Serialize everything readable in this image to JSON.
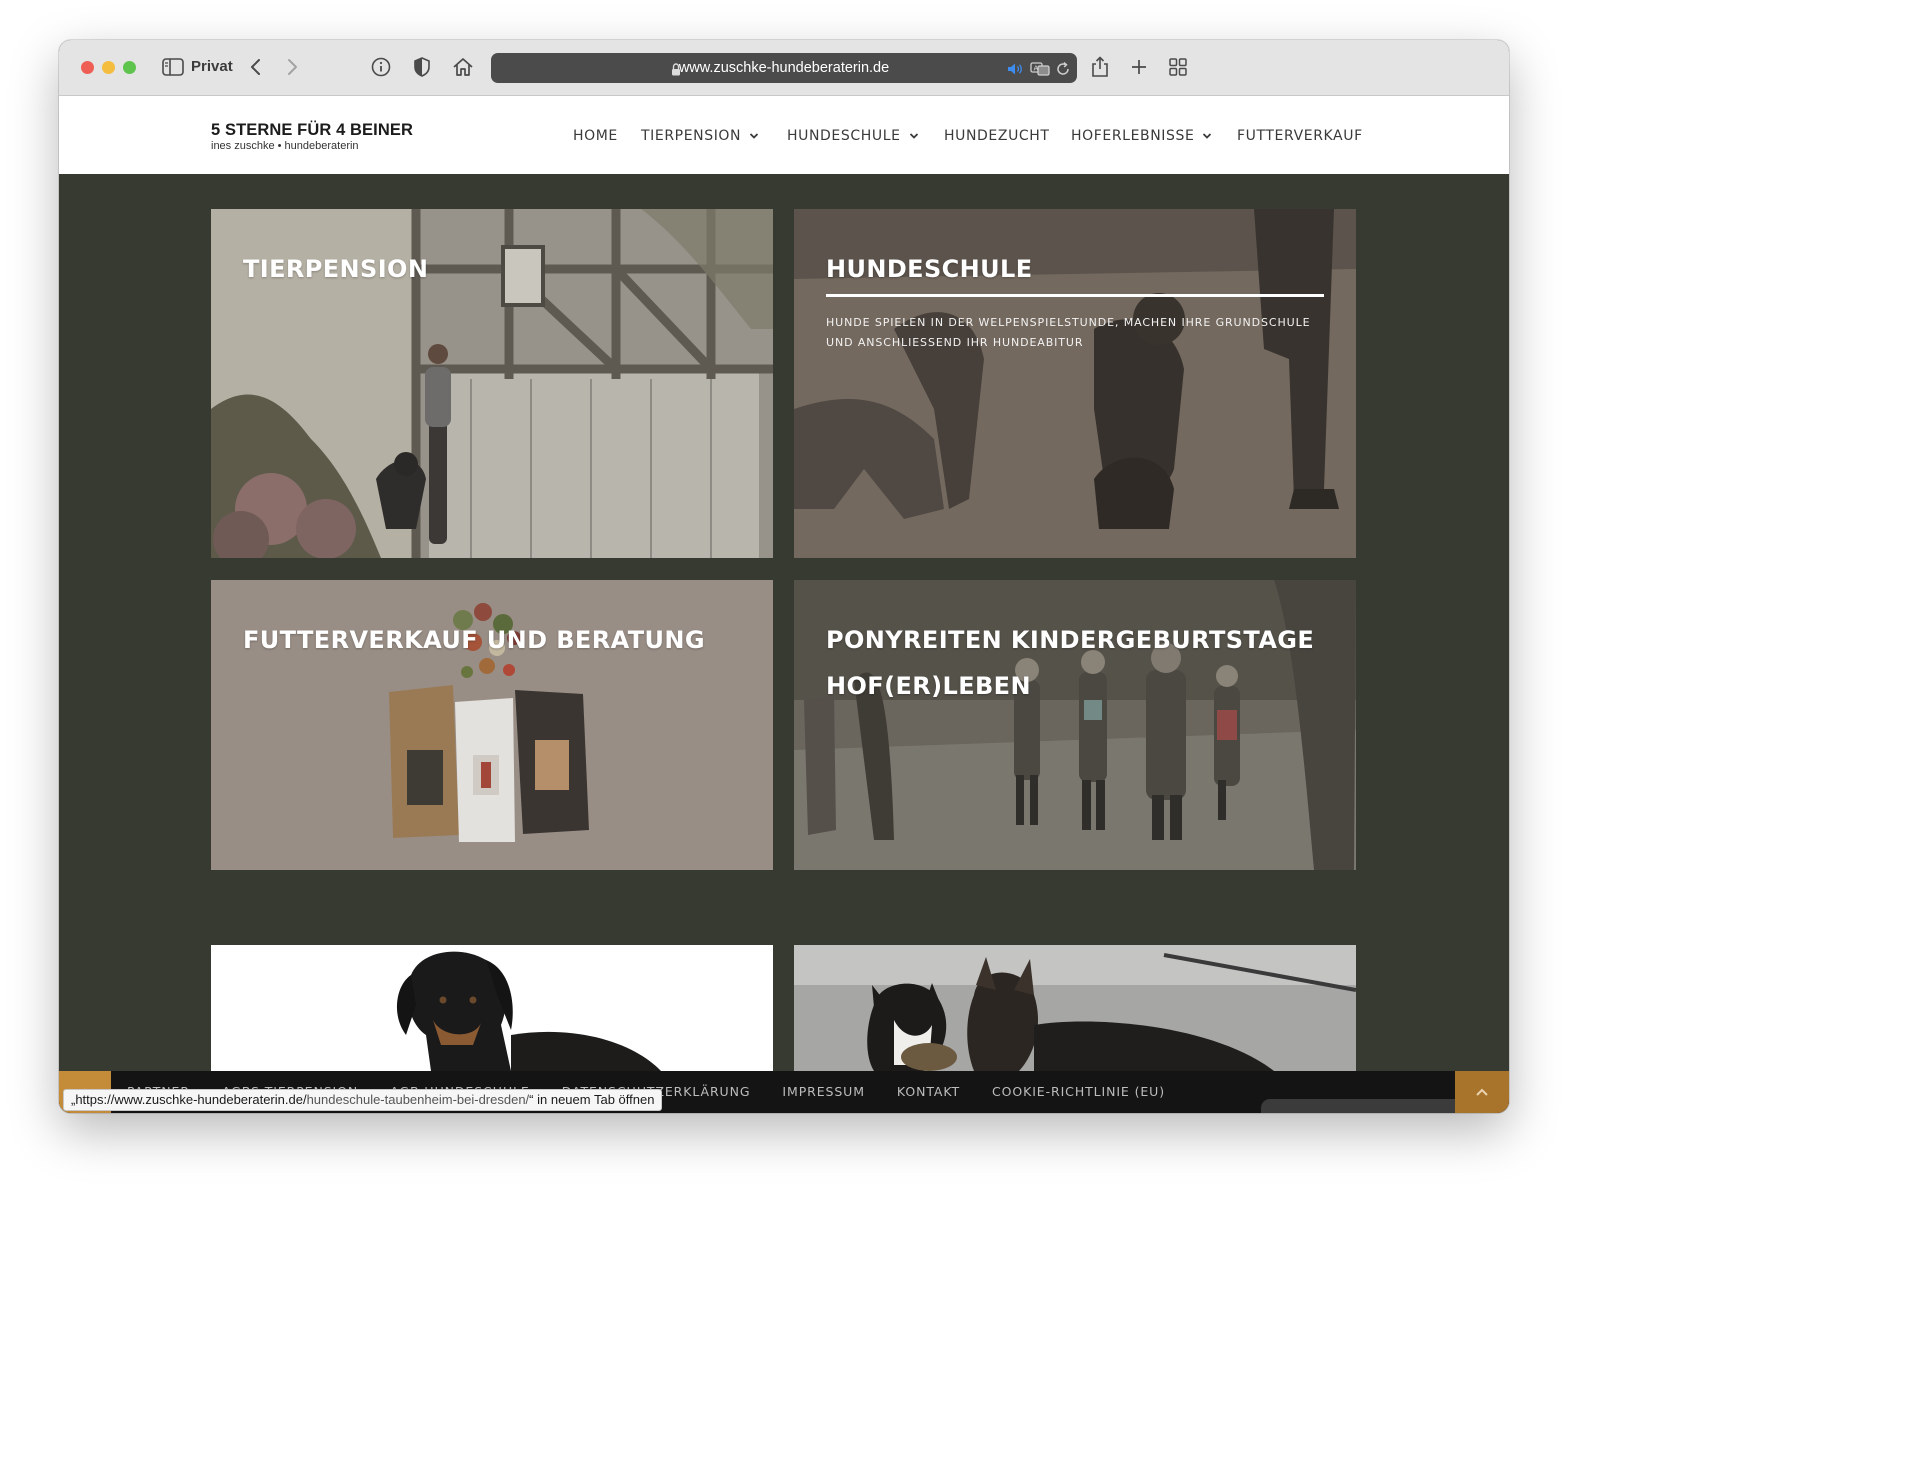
{
  "browser": {
    "mode_label": "Privat",
    "url": "www.zuschke-hundeberaterin.de"
  },
  "site": {
    "logo_title": "5 STERNE FÜR 4 BEINER",
    "logo_subtitle": "ines zuschke • hundeberaterin"
  },
  "nav": {
    "items": [
      {
        "label": "HOME",
        "dropdown": false
      },
      {
        "label": "TIERPENSION",
        "dropdown": true
      },
      {
        "label": "HUNDESCHULE",
        "dropdown": true
      },
      {
        "label": "HUNDEZUCHT",
        "dropdown": false
      },
      {
        "label": "HOFERLEBNISSE",
        "dropdown": true
      },
      {
        "label": "FUTTERVERKAUF",
        "dropdown": false
      }
    ]
  },
  "tiles": [
    {
      "title": "TIERPENSION"
    },
    {
      "title": "HUNDESCHULE",
      "description": "HUNDE SPIELEN IN DER WELPENSPIELSTUNDE, MACHEN IHRE GRUNDSCHULE UND ANSCHLIESSEND IHR HUNDEABITUR"
    },
    {
      "title": "FUTTERVERKAUF UND BERATUNG"
    },
    {
      "title_line1": "PONYREITEN KINDERGEBURTSTAGE",
      "title_line2": "HOF(ER)LEBEN"
    }
  ],
  "footer": {
    "links": [
      "PARTNER",
      "AGBS TIERPENSION",
      "AGB HUNDESCHULE",
      "DATENSCHUTZERKLÄRUNG",
      "IMPRESSUM",
      "KONTAKT",
      "COOKIE-RICHTLINIE (EU)"
    ]
  },
  "status_tooltip": {
    "prefix": "„https://www.zuschke-hundeberaterin.de/",
    "path": "hundeschule-taubenheim-bei-dresden/",
    "suffix": "“ in neuem Tab öffnen"
  },
  "colors": {
    "page_background": "#363a31",
    "footer_background": "#141414",
    "accent": "#c48b38"
  }
}
